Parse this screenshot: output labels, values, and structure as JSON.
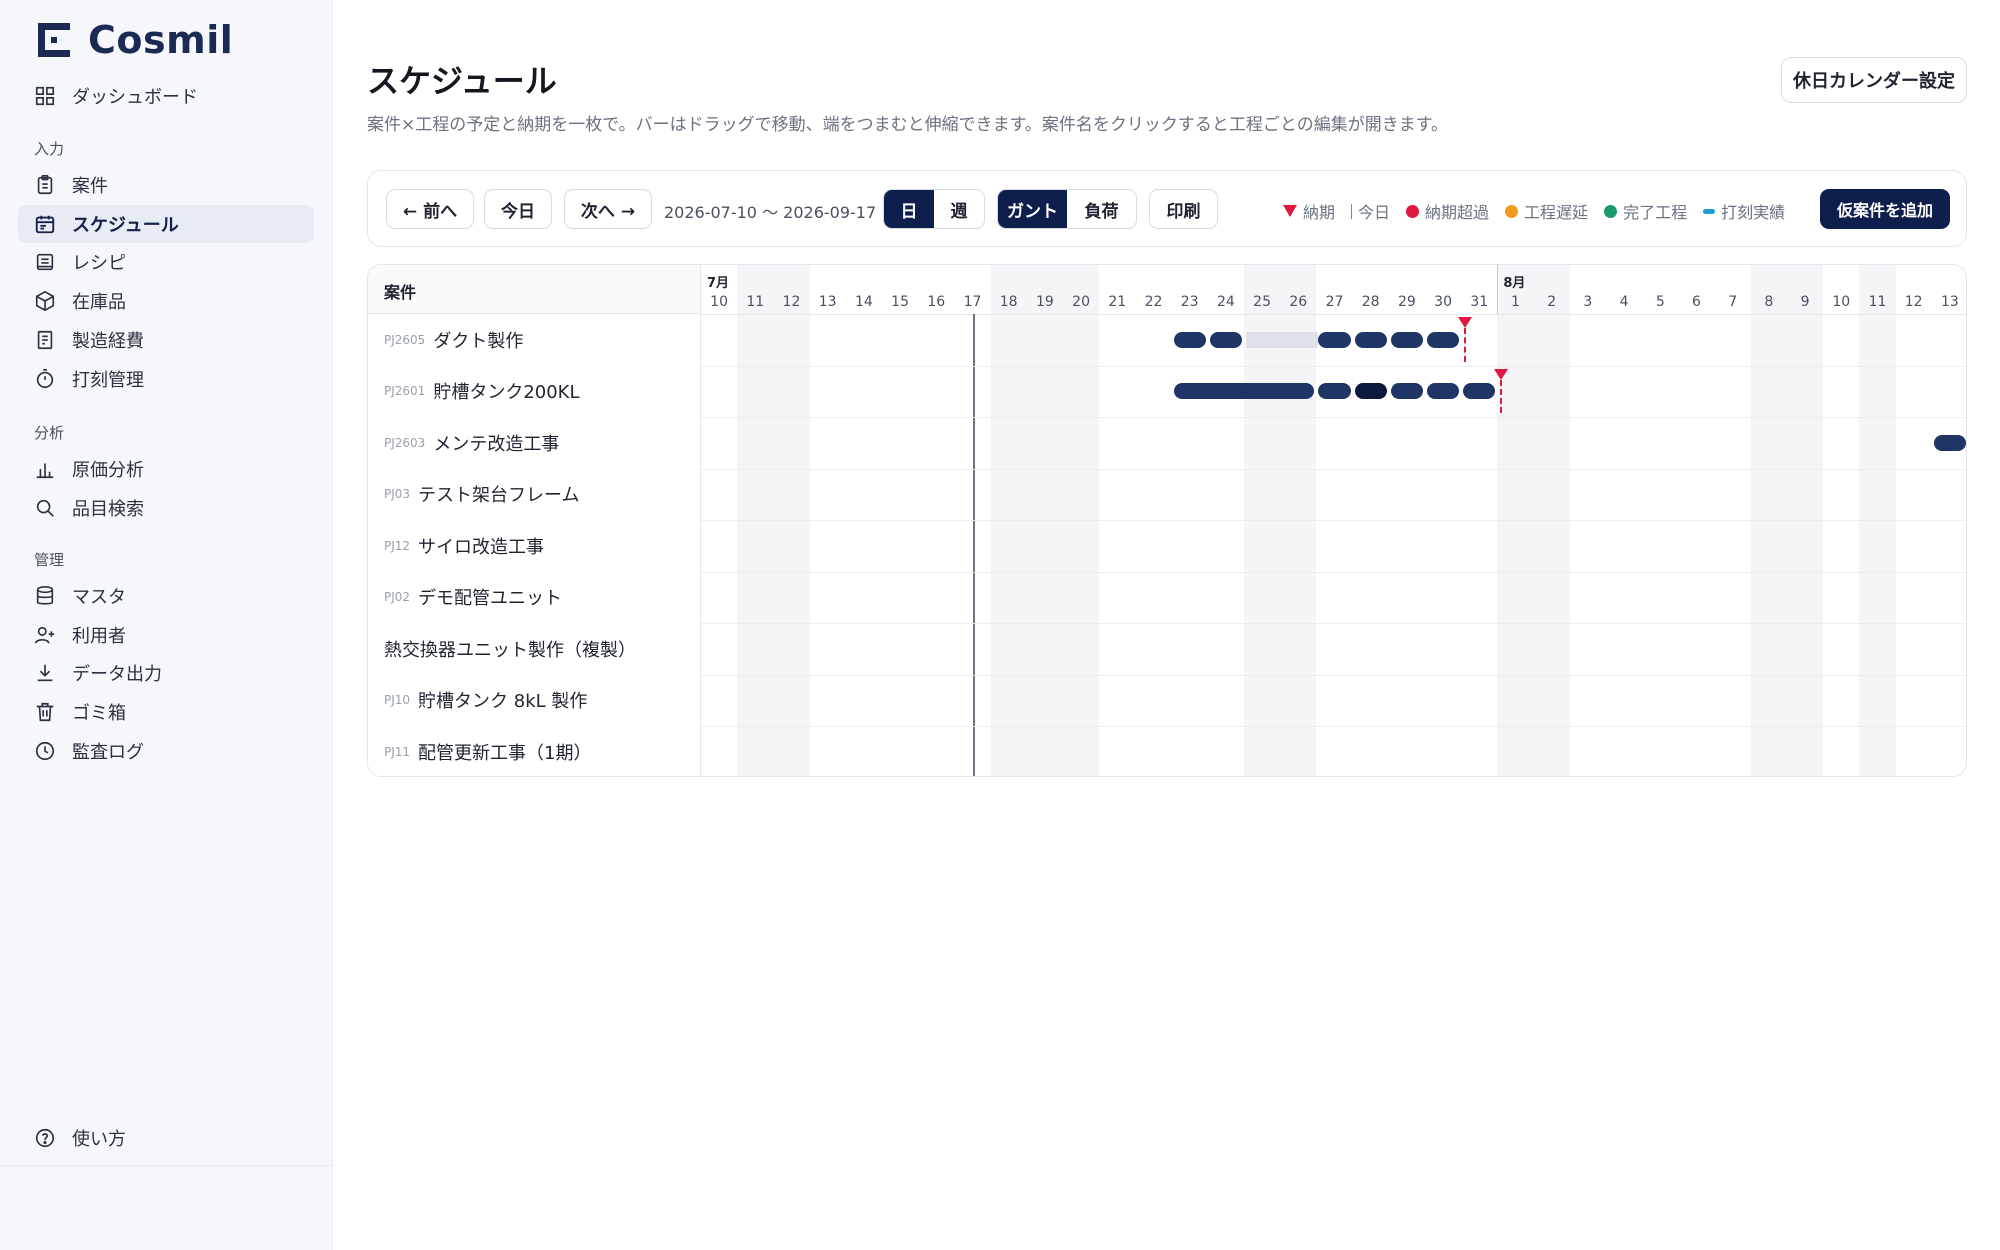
{
  "app": {
    "name": "Cosmil"
  },
  "sidebar": {
    "top_item": {
      "label": "ダッシュボード",
      "icon": "dashboard-icon"
    },
    "sections": [
      {
        "label": "入力",
        "items": [
          {
            "label": "案件",
            "icon": "clipboard-icon"
          },
          {
            "label": "スケジュール",
            "icon": "calendar-icon",
            "active": true
          },
          {
            "label": "レシピ",
            "icon": "recipe-icon"
          },
          {
            "label": "在庫品",
            "icon": "box-icon"
          },
          {
            "label": "製造経費",
            "icon": "receipt-icon"
          },
          {
            "label": "打刻管理",
            "icon": "timer-icon"
          }
        ]
      },
      {
        "label": "分析",
        "items": [
          {
            "label": "原価分析",
            "icon": "bar-chart-icon"
          },
          {
            "label": "品目検索",
            "icon": "search-icon"
          }
        ]
      },
      {
        "label": "管理",
        "items": [
          {
            "label": "マスタ",
            "icon": "database-icon"
          },
          {
            "label": "利用者",
            "icon": "user-plus-icon"
          },
          {
            "label": "データ出力",
            "icon": "download-icon"
          },
          {
            "label": "ゴミ箱",
            "icon": "trash-icon"
          },
          {
            "label": "監査ログ",
            "icon": "clock-icon"
          }
        ]
      }
    ],
    "help": {
      "label": "使い方",
      "icon": "help-icon"
    }
  },
  "header": {
    "title": "スケジュール",
    "description": "案件×工程の予定と納期を一枚で。バーはドラッグで移動、端をつまむと伸縮できます。案件名をクリックすると工程ごとの編集が開きます。",
    "holiday_button": "休日カレンダー設定"
  },
  "toolbar": {
    "prev": "← 前へ",
    "today": "今日",
    "next": "次へ →",
    "range": "2026-07-10 〜 2026-09-17",
    "scale_day": "日",
    "scale_week": "週",
    "view_gantt": "ガント",
    "view_load": "負荷",
    "print": "印刷",
    "legend": {
      "deadline": "納期",
      "today": "今日",
      "overdue": "納期超過",
      "delayed": "工程遅延",
      "done": "完了工程",
      "actual": "打刻実績"
    },
    "colors": {
      "deadline": "#e0173f",
      "overdue": "#e0173f",
      "delayed": "#f29b1d",
      "done": "#1a9a6b",
      "actual": "#1e9ad6"
    },
    "add_button": "仮案件を追加"
  },
  "gantt": {
    "column_header": "案件",
    "month_labels": [
      {
        "label": "7月",
        "start_index": 0
      },
      {
        "label": "8月",
        "start_index": 22
      }
    ],
    "days": [
      "10",
      "11",
      "12",
      "13",
      "14",
      "15",
      "16",
      "17",
      "18",
      "19",
      "20",
      "21",
      "22",
      "23",
      "24",
      "25",
      "26",
      "27",
      "28",
      "29",
      "30",
      "31",
      "1",
      "2",
      "3",
      "4",
      "5",
      "6",
      "7",
      "8",
      "9",
      "10",
      "11",
      "12",
      "13"
    ],
    "weekend_indices": [
      1,
      2,
      8,
      9,
      10,
      15,
      16,
      22,
      23,
      29,
      30,
      32
    ],
    "today_index": 7.5,
    "rows": [
      {
        "code": "PJ2605",
        "name": "ダクト製作",
        "bars": [
          [
            13,
            14,
            "n"
          ],
          [
            14,
            15,
            "n"
          ],
          [
            15,
            17,
            "light"
          ],
          [
            17,
            18,
            "n"
          ],
          [
            18,
            19,
            "n"
          ],
          [
            19,
            20,
            "n"
          ],
          [
            20,
            21,
            "n"
          ]
        ],
        "deadline": 21.1
      },
      {
        "code": "PJ2601",
        "name": "貯槽タンク200KL",
        "bars": [
          [
            13,
            17,
            "n"
          ],
          [
            17,
            18,
            "n"
          ],
          [
            18,
            19,
            "dark"
          ],
          [
            19,
            20,
            "n"
          ],
          [
            20,
            21,
            "n"
          ],
          [
            21,
            22,
            "n"
          ]
        ],
        "deadline": 22.1
      },
      {
        "code": "PJ2603",
        "name": "メンテ改造工事",
        "bars": [
          [
            34,
            35,
            "n"
          ]
        ]
      },
      {
        "code": "PJ03",
        "name": "テスト架台フレーム",
        "bars": []
      },
      {
        "code": "PJ12",
        "name": "サイロ改造工事",
        "bars": []
      },
      {
        "code": "PJ02",
        "name": "デモ配管ユニット",
        "bars": []
      },
      {
        "code": "",
        "name": "熱交換器ユニット製作（複製）",
        "bars": []
      },
      {
        "code": "PJ10",
        "name": "貯槽タンク 8kL 製作",
        "bars": []
      },
      {
        "code": "PJ11",
        "name": "配管更新工事（1期）",
        "bars": []
      }
    ]
  }
}
